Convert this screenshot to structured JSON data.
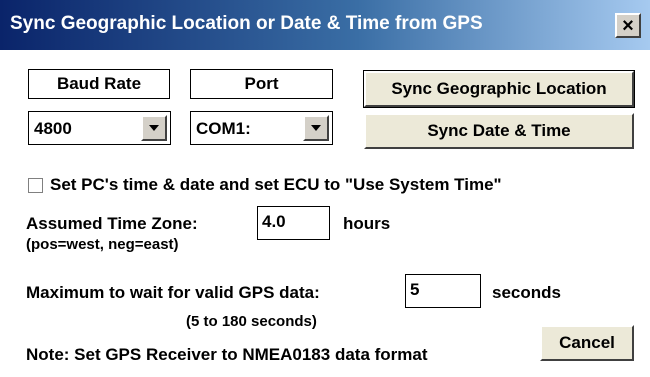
{
  "window": {
    "title": "Sync Geographic Location or Date & Time from GPS",
    "close_label": "×"
  },
  "labels": {
    "baud_rate": "Baud Rate",
    "port": "Port"
  },
  "baud": {
    "value": "4800"
  },
  "port": {
    "value": "COM1:"
  },
  "buttons": {
    "sync_location": "Sync Geographic Location",
    "sync_datetime": "Sync Date & Time",
    "cancel": "Cancel"
  },
  "checkbox": {
    "label": "Set PC's time & date and set ECU to \"Use System Time\"",
    "checked": false
  },
  "timezone": {
    "label": "Assumed Time Zone:",
    "hint": "(pos=west, neg=east)",
    "value": "4.0",
    "unit": "hours"
  },
  "gps_wait": {
    "label": "Maximum to wait for valid GPS data:",
    "value": "5",
    "unit": "seconds",
    "range": "(5 to 180 seconds)"
  },
  "note": "Note: Set GPS Receiver to NMEA0183 data format"
}
